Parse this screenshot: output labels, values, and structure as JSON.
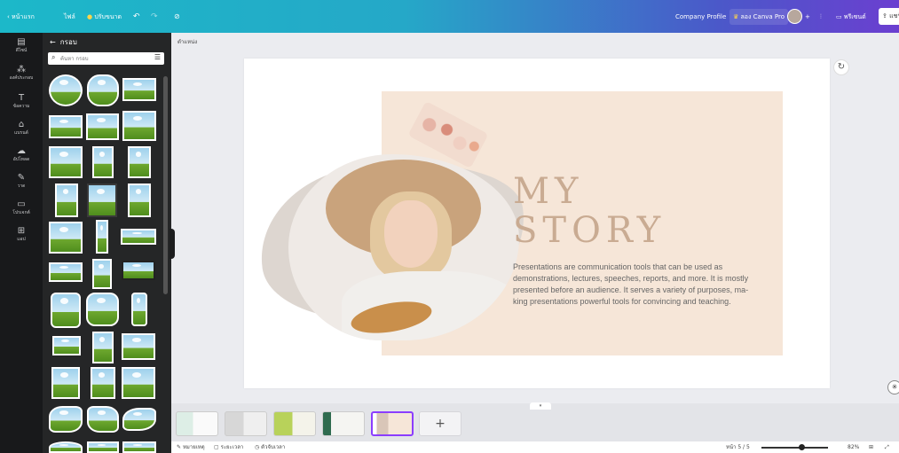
{
  "topbar": {
    "home": "หน้าแรก",
    "file": "ไฟล์",
    "resize": "ปรับขนาด",
    "undo_icon": "undo-icon",
    "redo_icon": "redo-icon",
    "sync_icon": "cloud-sync-icon",
    "doc_title": "Company Profile",
    "pro": "ลอง Canva Pro",
    "add": "+",
    "present": "พรีเซนต์",
    "share": "แชร์"
  },
  "rail": {
    "items": [
      {
        "label": "ดีไซน์",
        "icon": "design-icon"
      },
      {
        "label": "องค์ประกอบ",
        "icon": "elements-icon"
      },
      {
        "label": "ข้อความ",
        "icon": "text-icon"
      },
      {
        "label": "แบรนด์",
        "icon": "brand-icon"
      },
      {
        "label": "อัปโหลด",
        "icon": "upload-icon"
      },
      {
        "label": "วาด",
        "icon": "draw-icon"
      },
      {
        "label": "โปรเจกต์",
        "icon": "folder-icon"
      },
      {
        "label": "แอป",
        "icon": "apps-icon"
      }
    ]
  },
  "panel": {
    "title": "กรอบ",
    "search_placeholder": "ค้นหา กรอบ"
  },
  "editor": {
    "breadcrumb": "ตำแหน่ง",
    "slide": {
      "title_line1": "MY",
      "title_line2": "STORY",
      "body": "Presentations are communication tools that can be used as demonstrations, lectures, speeches, reports, and more. It is mostly presented before an audience. It serves a variety of purposes, ma-king presentations powerful tools for convincing and teaching."
    }
  },
  "pages": {
    "count": 5,
    "active_index": 4,
    "add_label": "+"
  },
  "bottombar": {
    "notes": "หมายเหตุ",
    "duration": "ระยะเวลา",
    "timer": "ตัวจับเวลา",
    "page_indicator": "หน้า 5 / 5",
    "zoom": "82%"
  },
  "colors": {
    "topbar_start": "#1cb8c9",
    "topbar_end": "#6b3fd0",
    "rail": "#18191b",
    "panel": "#252627",
    "slide_beige": "#f6e6d8",
    "title_color": "#c9ab92",
    "active_thumb": "#8b3dff"
  }
}
